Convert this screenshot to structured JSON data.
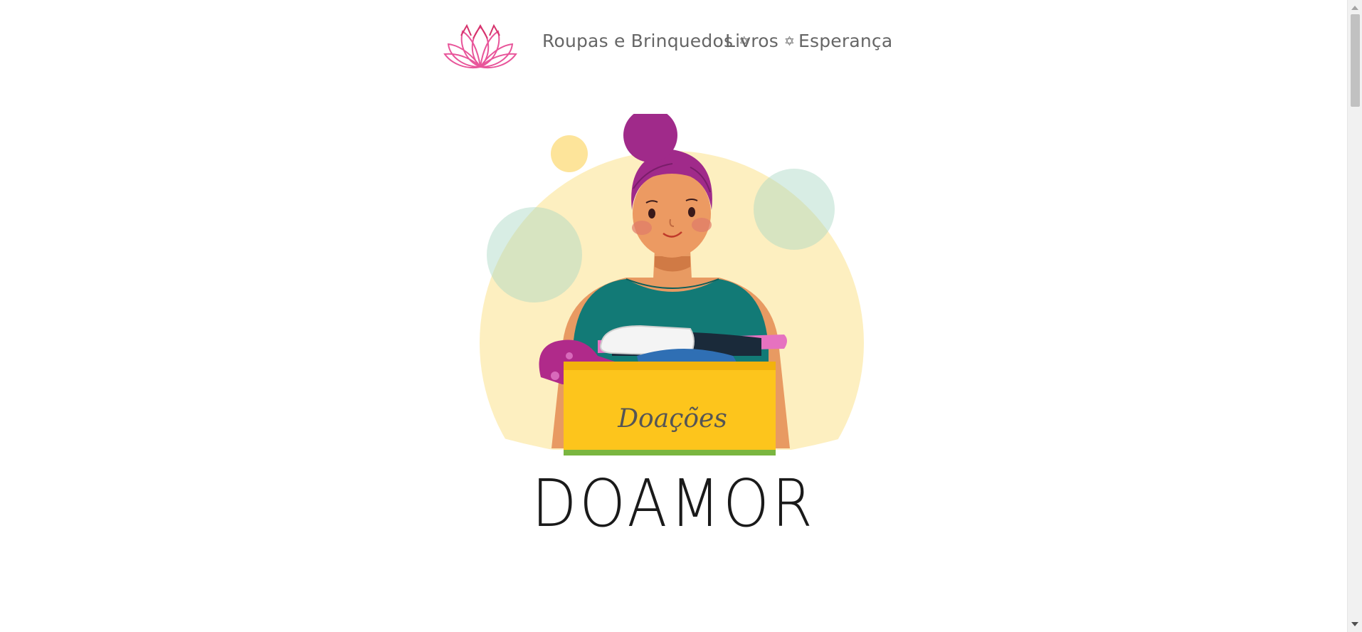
{
  "nav": {
    "items": [
      {
        "label": "Roupas e Brinquedos",
        "icon": "star-of-david-icon",
        "glyph": "✡"
      },
      {
        "label": "Livros",
        "icon": "star-of-david-icon",
        "glyph": "✡"
      },
      {
        "label": "Esperança"
      }
    ]
  },
  "hero": {
    "box_text": "Doações"
  },
  "brand": {
    "title": "DOAMOR"
  },
  "colors": {
    "logo_pink": "#e8559a",
    "sun_yellow": "#fdefc0",
    "bubble_green": "#cfe8d8",
    "hair_purple": "#a02a8a",
    "shirt_teal": "#127a76",
    "box_yellow": "#fdc51c",
    "nav_text": "#666666"
  }
}
